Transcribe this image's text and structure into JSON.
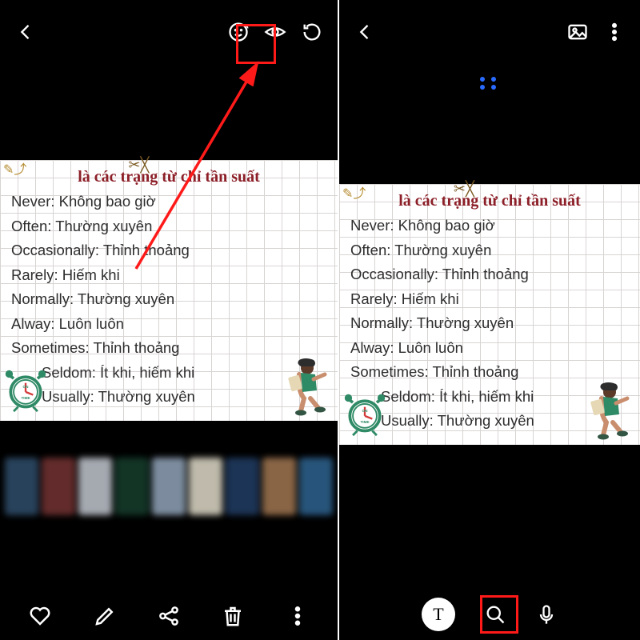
{
  "note": {
    "title": "là các trạng từ chỉ tần suất",
    "lines": [
      "Never: Không bao giờ",
      "Often: Thường xuyên",
      "Occasionally: Thỉnh thoảng",
      "Rarely: Hiếm khi",
      "Normally: Thường xuyên",
      "Alway: Luôn luôn",
      "Sometimes: Thỉnh thoảng",
      "Seldom: Ít khi, hiếm khi",
      "Usually: Thường xuyên"
    ]
  },
  "colors": {
    "thumbs": [
      "#2d4a66",
      "#6e3030",
      "#b7bcc4",
      "#153b2b",
      "#8a9cb0",
      "#d4cfbe",
      "#203a5f",
      "#98704d",
      "#2c5e88"
    ]
  },
  "icons": {
    "text_button": "T"
  }
}
